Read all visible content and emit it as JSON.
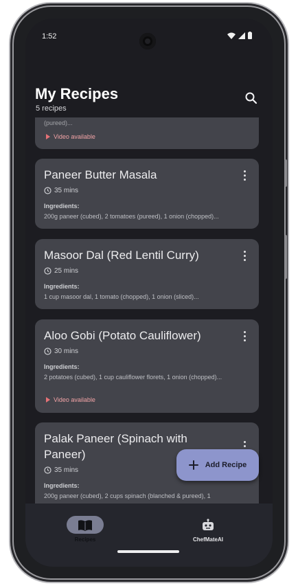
{
  "status_bar": {
    "time": "1:52"
  },
  "header": {
    "title": "My Recipes",
    "subtitle": "5 recipes"
  },
  "partial_card": {
    "ingredients_tail": "(pureed)...",
    "video_label": "Video available"
  },
  "recipes": [
    {
      "title": "Paneer Butter Masala",
      "time": "35 mins",
      "ingredients_label": "Ingredients:",
      "ingredients": "200g paneer (cubed), 2 tomatoes (pureed), 1 onion (chopped)..."
    },
    {
      "title": "Masoor Dal (Red Lentil Curry)",
      "time": "25 mins",
      "ingredients_label": "Ingredients:",
      "ingredients": "1 cup masoor dal, 1 tomato (chopped), 1 onion (sliced)..."
    },
    {
      "title": "Aloo Gobi (Potato Cauliflower)",
      "time": "30 mins",
      "ingredients_label": "Ingredients:",
      "ingredients": "2 potatoes (cubed), 1 cup cauliflower florets, 1 onion (chopped)...",
      "video_label": "Video available"
    },
    {
      "title": "Palak Paneer (Spinach with Paneer)",
      "time": "35 mins",
      "ingredients_label": "Ingredients:",
      "ingredients": "200g paneer (cubed), 2 cups spinach (blanched & pureed), 1"
    }
  ],
  "fab": {
    "label": "Add Recipe",
    "icon": "plus-icon"
  },
  "bottom_nav": {
    "items": [
      {
        "label": "Recipes",
        "icon": "book-icon",
        "selected": true
      },
      {
        "label": "ChefMateAI",
        "icon": "robot-icon",
        "selected": false
      }
    ]
  },
  "colors": {
    "screen_bg": "#1c1c21",
    "card_bg": "#43444b",
    "fab_bg": "#8d95cc",
    "video_accent": "#e57277",
    "nav_bg": "#25262d",
    "nav_pill_selected": "#7a7d92"
  }
}
